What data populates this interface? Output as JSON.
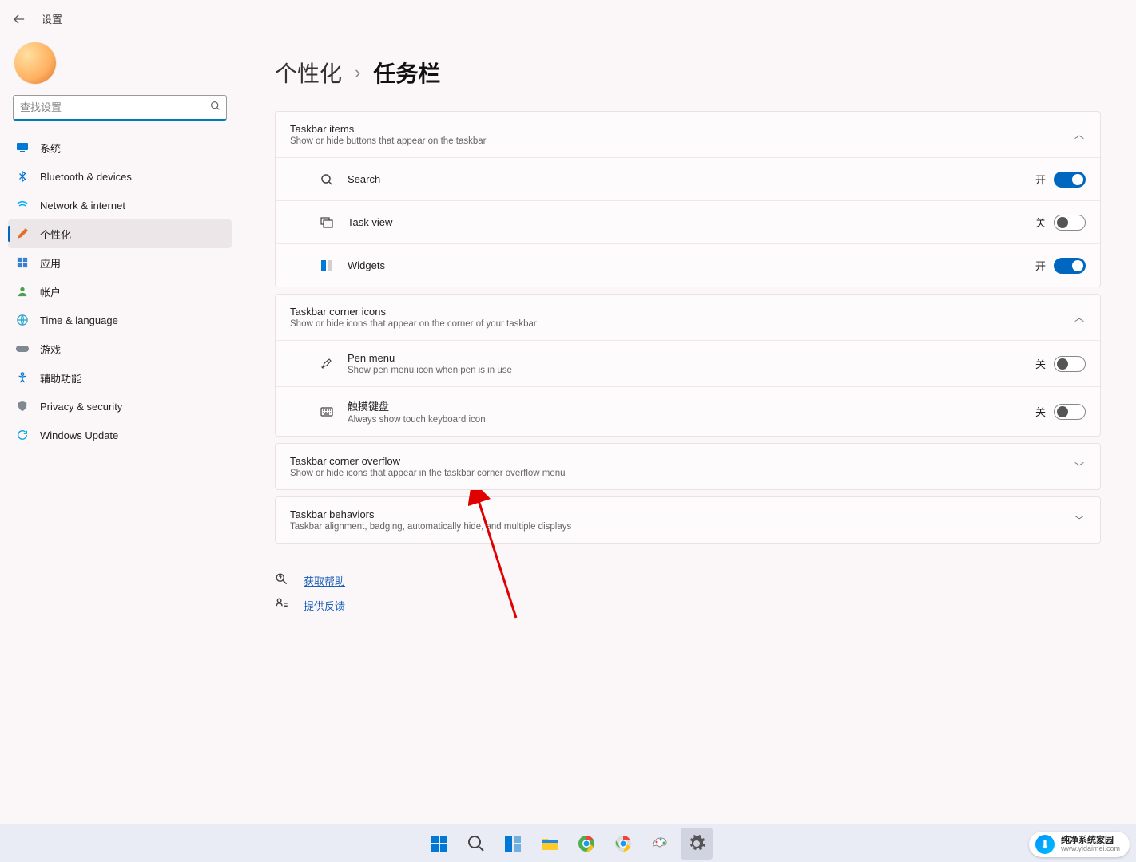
{
  "header": {
    "title": "设置"
  },
  "search": {
    "placeholder": "查找设置"
  },
  "sidebar": {
    "items": [
      {
        "label": "系统",
        "color": "#0078d4"
      },
      {
        "label": "Bluetooth & devices",
        "color": "#0078d4"
      },
      {
        "label": "Network & internet",
        "color": "#00b0ff"
      },
      {
        "label": "个性化",
        "color": "#e07030"
      },
      {
        "label": "应用",
        "color": "#3a80d0"
      },
      {
        "label": "帐户",
        "color": "#4aa050"
      },
      {
        "label": "Time & language",
        "color": "#1ea0d0"
      },
      {
        "label": "游戏",
        "color": "#808890"
      },
      {
        "label": "辅助功能",
        "color": "#0078d4"
      },
      {
        "label": "Privacy & security",
        "color": "#808890"
      },
      {
        "label": "Windows Update",
        "color": "#00a0e0"
      }
    ]
  },
  "breadcrumb": {
    "parent": "个性化",
    "current": "任务栏"
  },
  "sections": {
    "taskbarItems": {
      "title": "Taskbar items",
      "sub": "Show or hide buttons that appear on the taskbar",
      "rows": [
        {
          "label": "Search",
          "state": "开",
          "on": true
        },
        {
          "label": "Task view",
          "state": "关",
          "on": false
        },
        {
          "label": "Widgets",
          "state": "开",
          "on": true
        }
      ]
    },
    "cornerIcons": {
      "title": "Taskbar corner icons",
      "sub": "Show or hide icons that appear on the corner of your taskbar",
      "rows": [
        {
          "label": "Pen menu",
          "desc": "Show pen menu icon when pen is in use",
          "state": "关",
          "on": false
        },
        {
          "label": "触摸键盘",
          "desc": "Always show touch keyboard icon",
          "state": "关",
          "on": false
        }
      ]
    },
    "overflow": {
      "title": "Taskbar corner overflow",
      "sub": "Show or hide icons that appear in the taskbar corner overflow menu"
    },
    "behaviors": {
      "title": "Taskbar behaviors",
      "sub": "Taskbar alignment, badging, automatically hide, and multiple displays"
    }
  },
  "links": {
    "help": "获取帮助",
    "feedback": "提供反馈"
  },
  "watermark": {
    "main": "纯净系统家园",
    "sub": "www.yidaimei.com"
  }
}
